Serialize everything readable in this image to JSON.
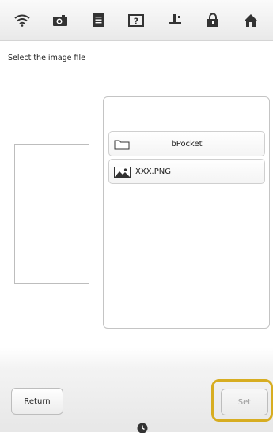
{
  "toolbar": {
    "icons": [
      "wifi-icon",
      "camera-icon",
      "document-icon",
      "help-icon",
      "presser-foot-icon",
      "lock-icon",
      "home-icon"
    ],
    "accent_color": "#d7ad21"
  },
  "main": {
    "instruction": "Select the image file"
  },
  "files": [
    {
      "type": "folder",
      "label": "bPocket"
    },
    {
      "type": "image",
      "label": "XXX.PNG"
    }
  ],
  "footer": {
    "return_label": "Return",
    "set_label": "Set"
  }
}
